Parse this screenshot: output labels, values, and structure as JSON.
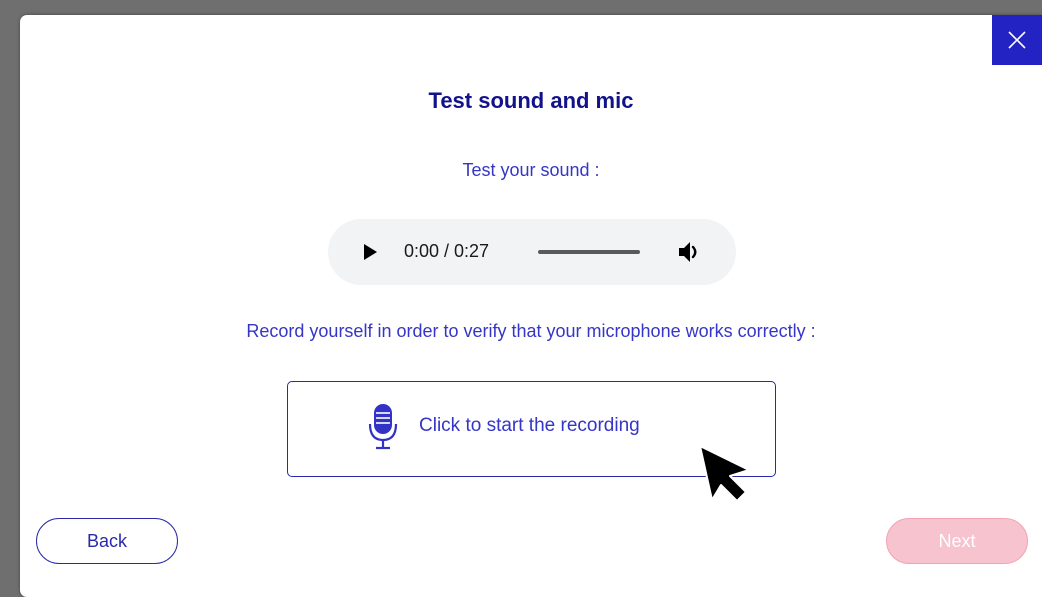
{
  "dialog": {
    "title": "Test sound and mic",
    "sound_prompt": "Test your sound :",
    "record_prompt": "Record yourself in order to verify that your microphone works correctly :"
  },
  "audio_player": {
    "time": "0:00 / 0:27",
    "progress": 0,
    "play_icon": "play-icon",
    "volume_icon": "volume-icon"
  },
  "recorder": {
    "label": "Click to start the recording",
    "icon": "microphone-icon"
  },
  "buttons": {
    "back": "Back",
    "next": "Next",
    "close_icon": "close-icon"
  },
  "colors": {
    "accent": "#2323c4",
    "title": "#12128a",
    "text": "#3535c8",
    "next_disabled": "#f7c3cf"
  }
}
